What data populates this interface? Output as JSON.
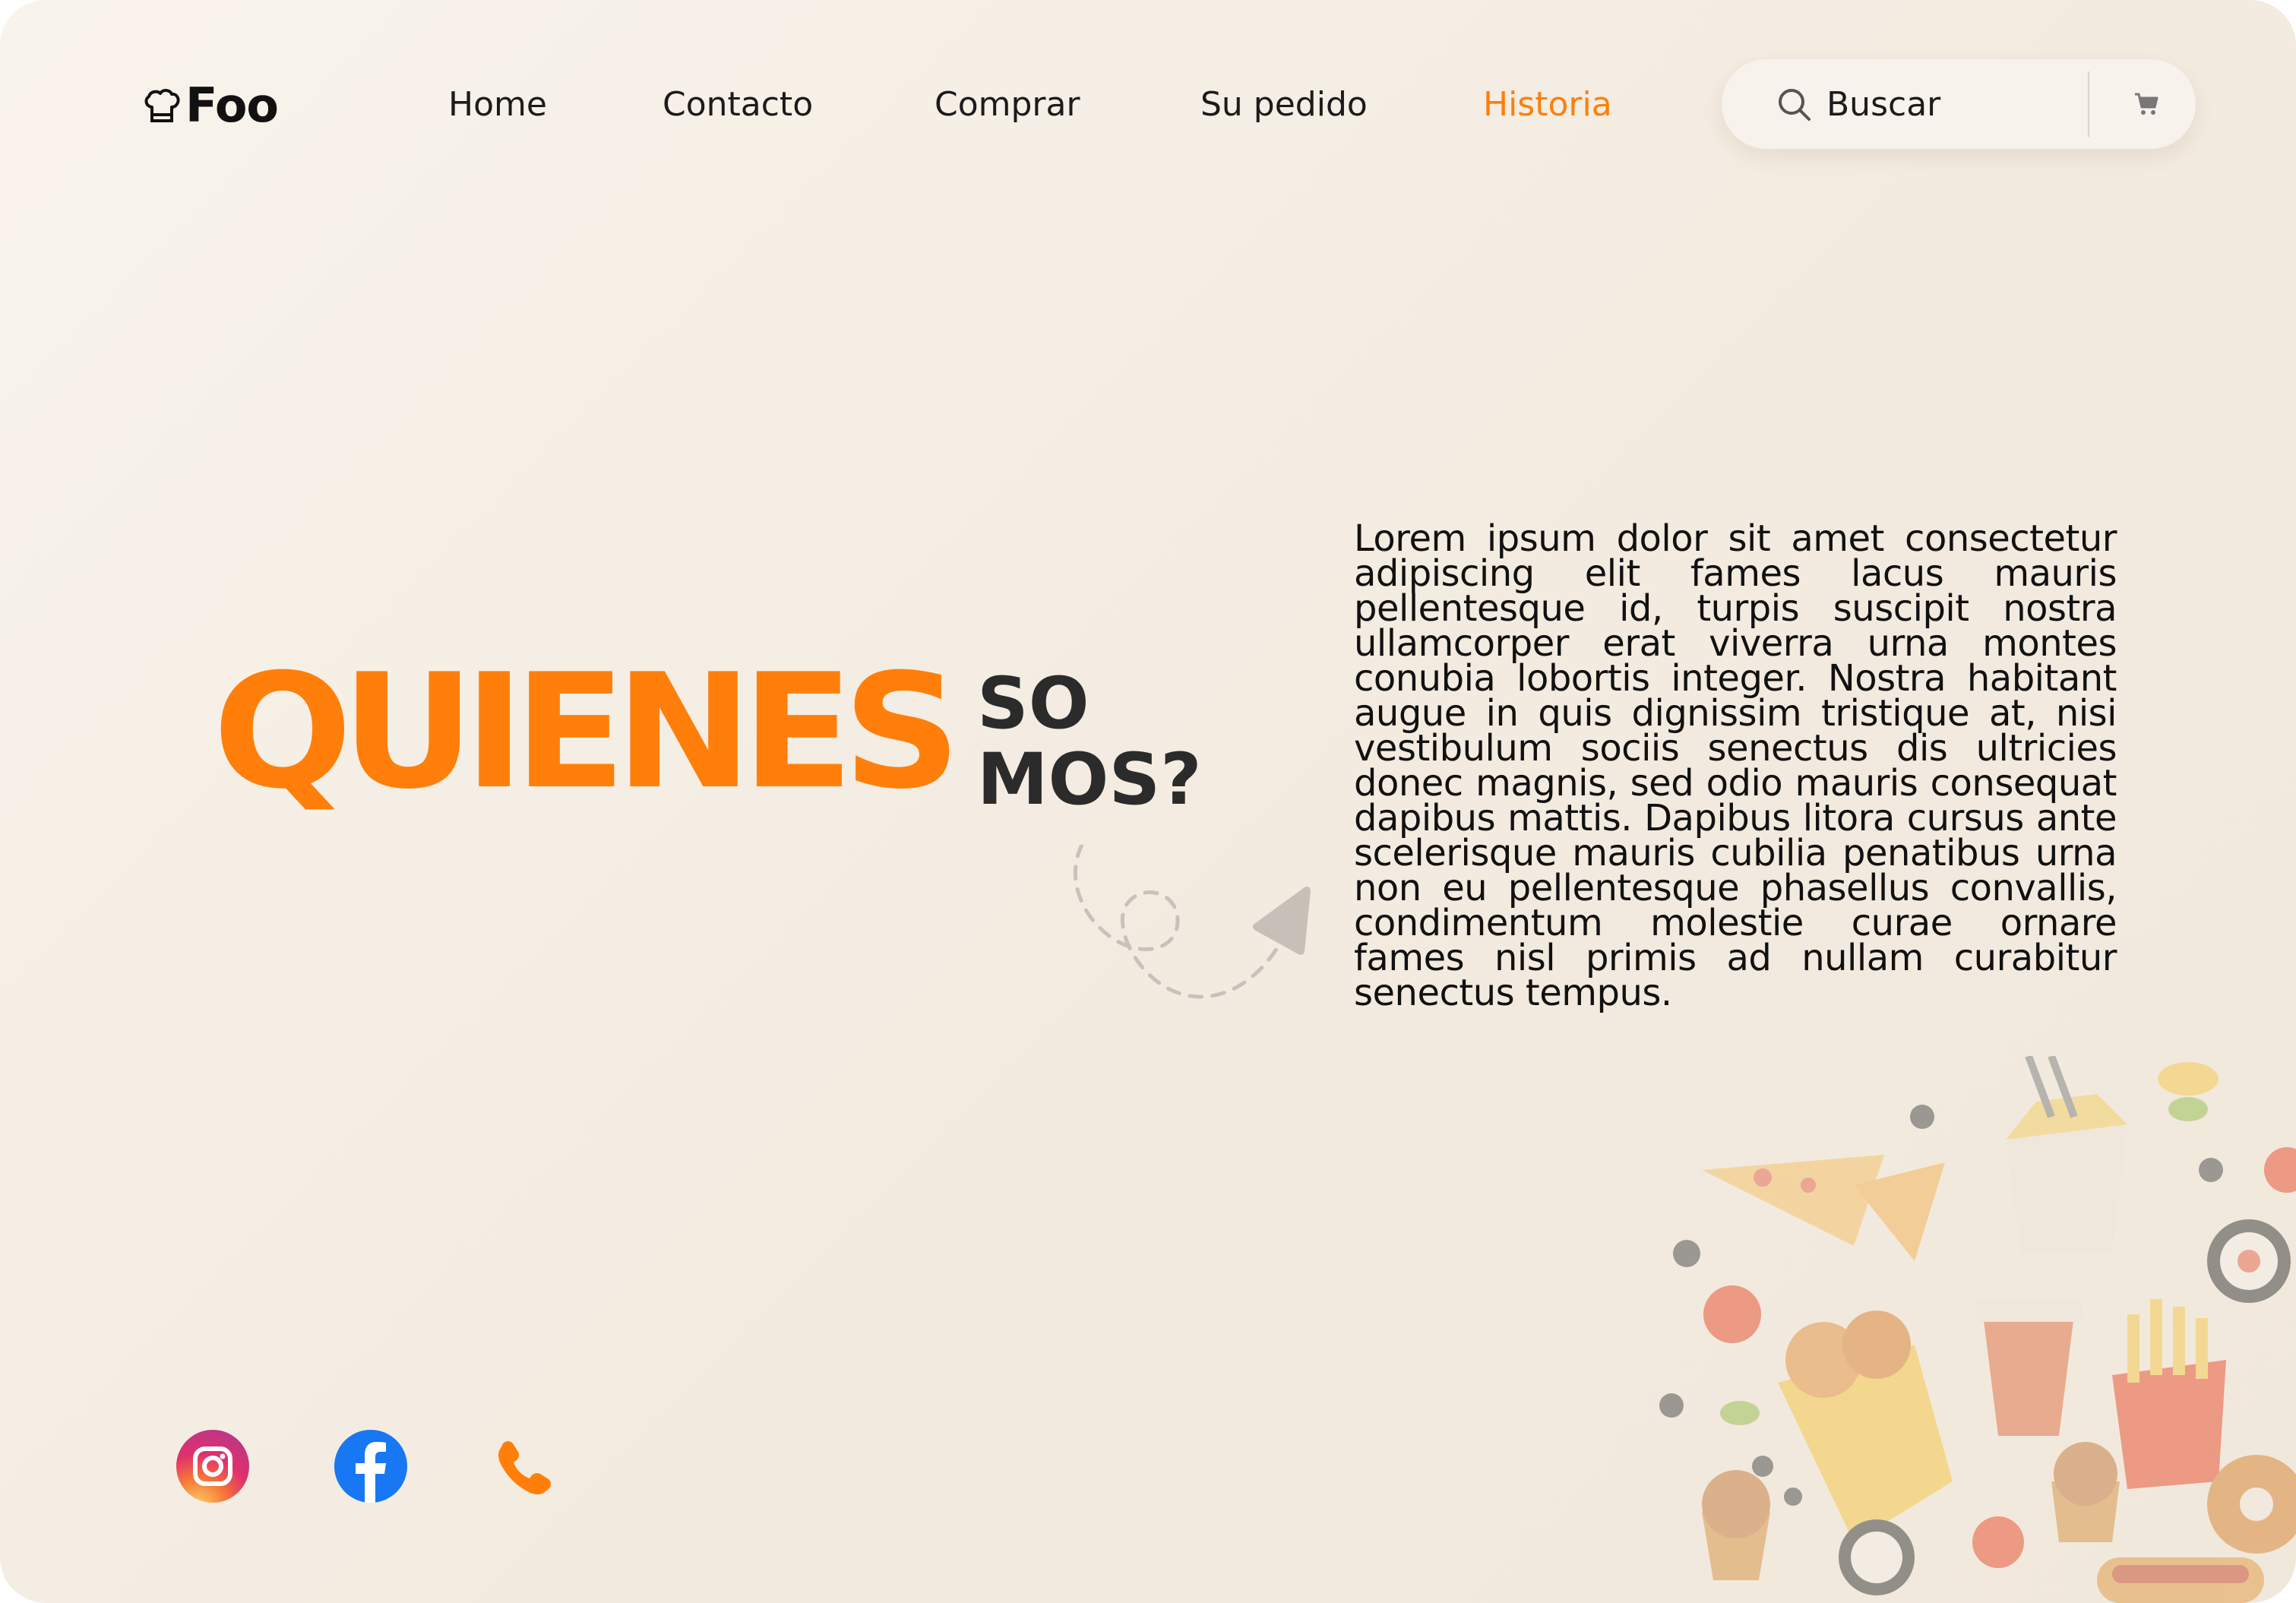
{
  "header": {
    "logo_text": "Foo",
    "logo_icon": "chef-hat-icon",
    "nav": [
      {
        "label": "Home",
        "active": false
      },
      {
        "label": "Contacto",
        "active": false
      },
      {
        "label": "Comprar",
        "active": false
      },
      {
        "label": "Su pedido",
        "active": false
      },
      {
        "label": "Historia",
        "active": true
      }
    ],
    "search": {
      "placeholder": "Buscar",
      "icon": "search-icon"
    },
    "cart_icon": "cart-icon"
  },
  "hero": {
    "title": "QUIENES",
    "subtitle_line1": "SO",
    "subtitle_line2": "MOS?",
    "description": "Lorem ipsum dolor sit amet consectetur adipiscing elit fames lacus mauris pellentesque id, turpis suscipit nostra ullamcorper erat viverra urna montes conubia lobortis integer. Nostra habitant augue in quis dignissim tristique at, nisi vestibulum sociis senectus dis ultricies donec magnis, sed odio mauris consequat dapibus mattis. Dapibus litora cursus ante scelerisque mauris cubilia penatibus urna non eu pellentesque phasellus convallis, condimentum molestie curae ornare fames nisl primis ad nullam curabitur senectus tempus."
  },
  "social": [
    {
      "name": "instagram",
      "icon": "instagram-icon"
    },
    {
      "name": "facebook",
      "icon": "facebook-icon"
    },
    {
      "name": "phone",
      "icon": "phone-icon"
    }
  ],
  "colors": {
    "accent": "#ff7f0a",
    "text_dark": "#1b1b1b",
    "background": "#f5eee5",
    "facebook": "#1877f2"
  }
}
